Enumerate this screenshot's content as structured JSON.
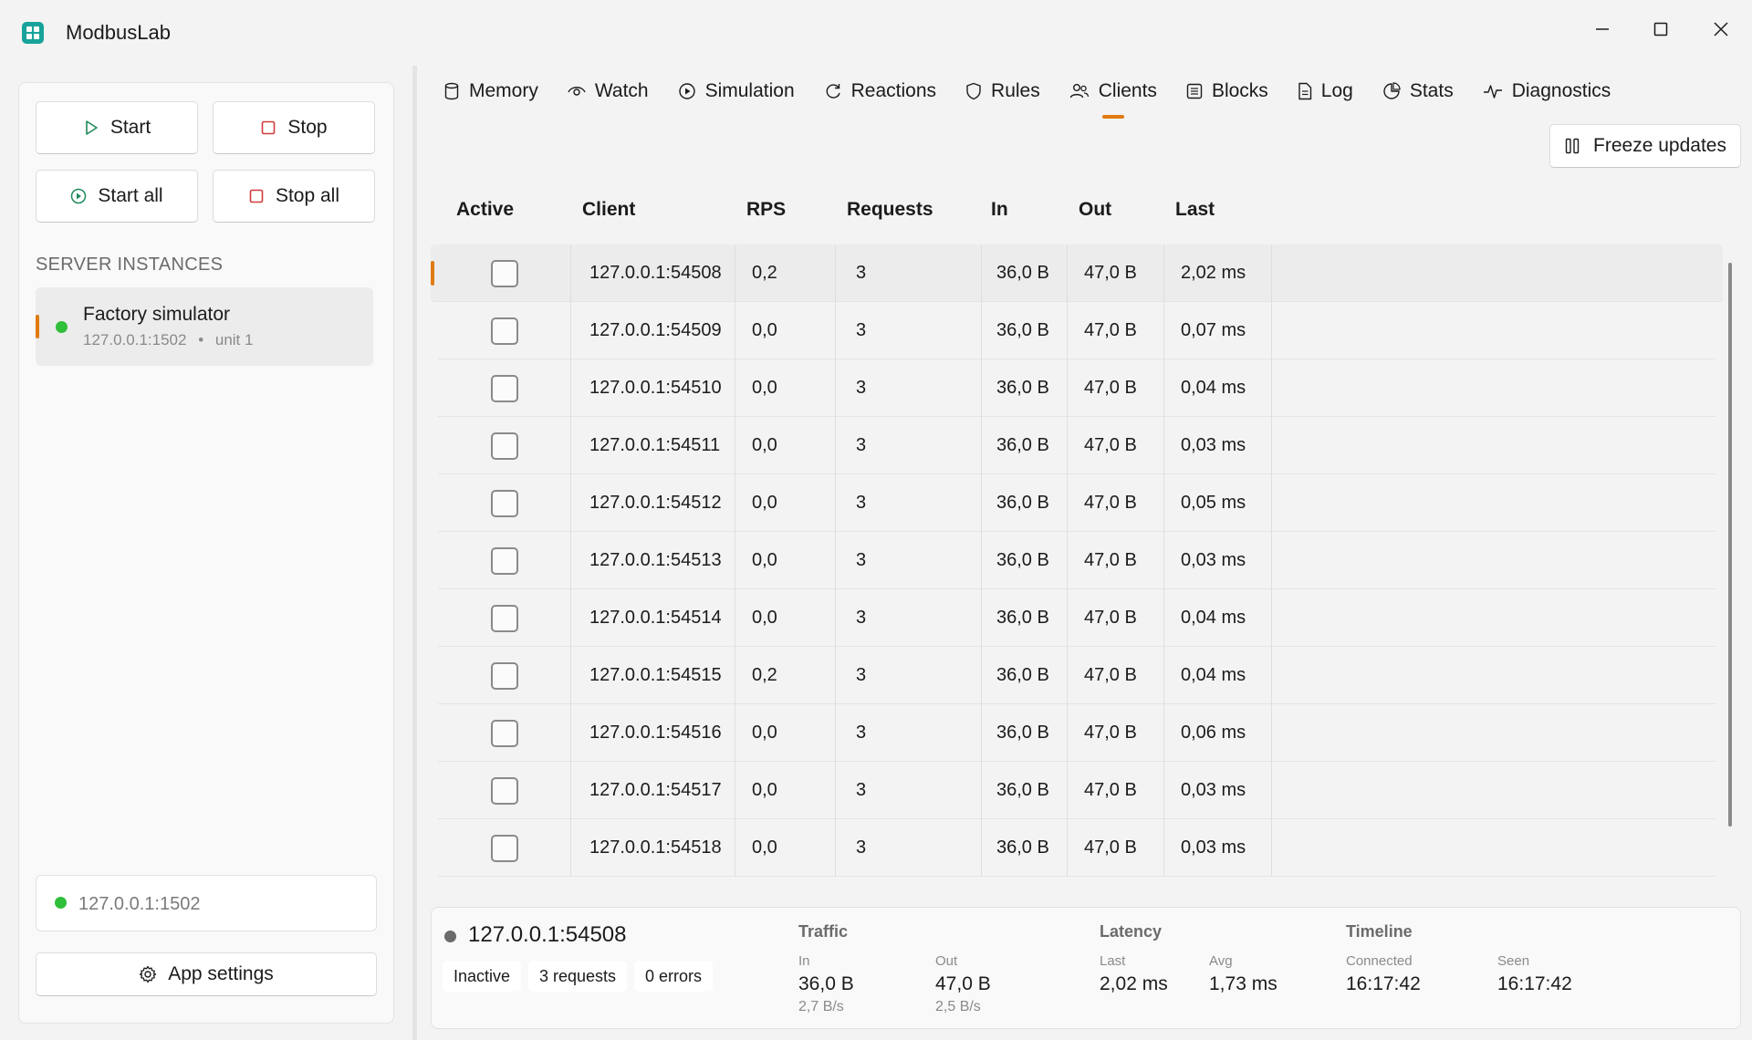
{
  "window": {
    "title": "ModbusLab"
  },
  "sidebar": {
    "start_label": "Start",
    "stop_label": "Stop",
    "start_all_label": "Start all",
    "stop_all_label": "Stop all",
    "section_label": "SERVER INSTANCES",
    "instances": [
      {
        "name": "Factory simulator",
        "address": "127.0.0.1:1502",
        "unit": "unit 1",
        "separator": "•",
        "status_color": "#2fbf3a"
      }
    ],
    "endpoint": "127.0.0.1:1502",
    "settings_label": "App settings"
  },
  "tabs": [
    {
      "label": "Memory",
      "icon": "database-icon"
    },
    {
      "label": "Watch",
      "icon": "eye-icon"
    },
    {
      "label": "Simulation",
      "icon": "play-circle-icon"
    },
    {
      "label": "Reactions",
      "icon": "refresh-icon"
    },
    {
      "label": "Rules",
      "icon": "shield-icon"
    },
    {
      "label": "Clients",
      "icon": "users-icon",
      "active": true
    },
    {
      "label": "Blocks",
      "icon": "grid-icon"
    },
    {
      "label": "Log",
      "icon": "document-icon"
    },
    {
      "label": "Stats",
      "icon": "chart-icon"
    },
    {
      "label": "Diagnostics",
      "icon": "pulse-icon"
    }
  ],
  "toolbar": {
    "freeze_label": "Freeze updates"
  },
  "table": {
    "headers": [
      "Active",
      "Client",
      "RPS",
      "Requests",
      "In",
      "Out",
      "Last"
    ],
    "rows": [
      {
        "client": "127.0.0.1:54508",
        "rps": "0,2",
        "requests": "3",
        "in": "36,0 B",
        "out": "47,0 B",
        "last": "2,02 ms",
        "selected": true
      },
      {
        "client": "127.0.0.1:54509",
        "rps": "0,0",
        "requests": "3",
        "in": "36,0 B",
        "out": "47,0 B",
        "last": "0,07 ms"
      },
      {
        "client": "127.0.0.1:54510",
        "rps": "0,0",
        "requests": "3",
        "in": "36,0 B",
        "out": "47,0 B",
        "last": "0,04 ms"
      },
      {
        "client": "127.0.0.1:54511",
        "rps": "0,0",
        "requests": "3",
        "in": "36,0 B",
        "out": "47,0 B",
        "last": "0,03 ms"
      },
      {
        "client": "127.0.0.1:54512",
        "rps": "0,0",
        "requests": "3",
        "in": "36,0 B",
        "out": "47,0 B",
        "last": "0,05 ms"
      },
      {
        "client": "127.0.0.1:54513",
        "rps": "0,0",
        "requests": "3",
        "in": "36,0 B",
        "out": "47,0 B",
        "last": "0,03 ms"
      },
      {
        "client": "127.0.0.1:54514",
        "rps": "0,0",
        "requests": "3",
        "in": "36,0 B",
        "out": "47,0 B",
        "last": "0,04 ms"
      },
      {
        "client": "127.0.0.1:54515",
        "rps": "0,2",
        "requests": "3",
        "in": "36,0 B",
        "out": "47,0 B",
        "last": "0,04 ms"
      },
      {
        "client": "127.0.0.1:54516",
        "rps": "0,0",
        "requests": "3",
        "in": "36,0 B",
        "out": "47,0 B",
        "last": "0,06 ms"
      },
      {
        "client": "127.0.0.1:54517",
        "rps": "0,0",
        "requests": "3",
        "in": "36,0 B",
        "out": "47,0 B",
        "last": "0,03 ms"
      },
      {
        "client": "127.0.0.1:54518",
        "rps": "0,0",
        "requests": "3",
        "in": "36,0 B",
        "out": "47,0 B",
        "last": "0,03 ms"
      }
    ]
  },
  "detail": {
    "client": "127.0.0.1:54508",
    "status_badge": "Inactive",
    "requests_badge": "3 requests",
    "errors_badge": "0 errors",
    "traffic": {
      "title": "Traffic",
      "in_label": "In",
      "in_value": "36,0 B",
      "in_rate": "2,7 B/s",
      "out_label": "Out",
      "out_value": "47,0 B",
      "out_rate": "2,5 B/s"
    },
    "latency": {
      "title": "Latency",
      "last_label": "Last",
      "last_value": "2,02 ms",
      "avg_label": "Avg",
      "avg_value": "1,73 ms"
    },
    "timeline": {
      "title": "Timeline",
      "connected_label": "Connected",
      "connected_value": "16:17:42",
      "seen_label": "Seen",
      "seen_value": "16:17:42"
    }
  },
  "colors": {
    "accent": "#e07b12",
    "brand": "#18a39a",
    "online": "#2fbf3a",
    "offline": "#6b6b6b"
  }
}
